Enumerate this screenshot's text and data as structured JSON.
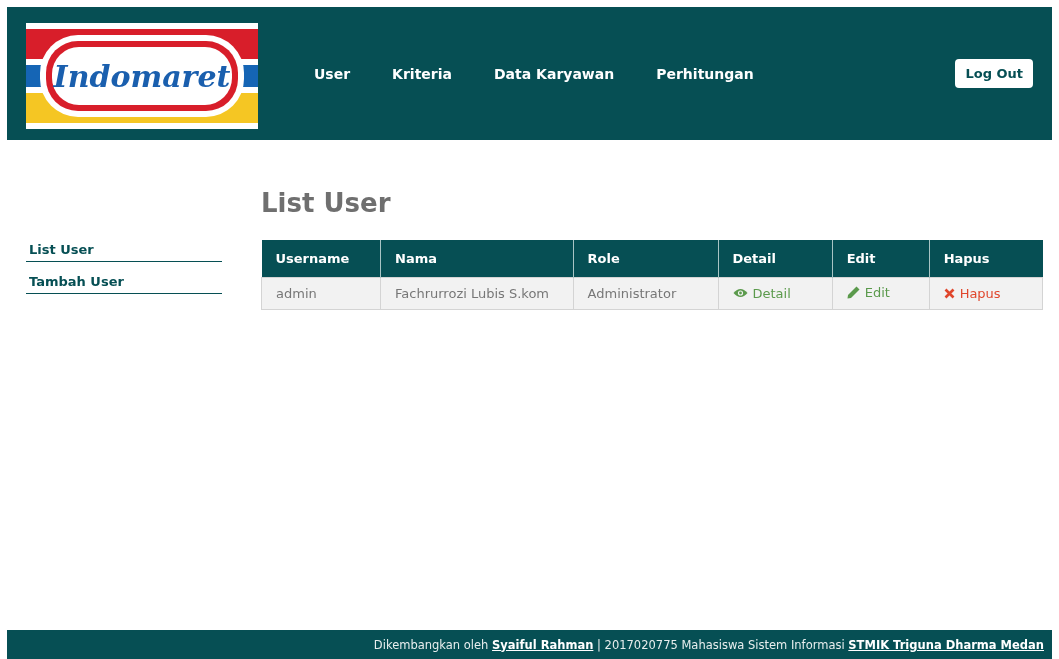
{
  "header": {
    "logo_text": "Indomaret",
    "nav": [
      {
        "label": "User"
      },
      {
        "label": "Kriteria"
      },
      {
        "label": "Data Karyawan"
      },
      {
        "label": "Perhitungan"
      }
    ],
    "logout": "Log Out"
  },
  "sidebar": {
    "items": [
      {
        "label": "List User"
      },
      {
        "label": "Tambah User"
      }
    ]
  },
  "page_title": "List User",
  "table": {
    "columns": [
      "Username",
      "Nama",
      "Role",
      "Detail",
      "Edit",
      "Hapus"
    ],
    "rows": [
      [
        {
          "kind": "text",
          "text": "admin"
        },
        {
          "kind": "text",
          "text": "Fachrurrozi Lubis S.kom"
        },
        {
          "kind": "text",
          "text": "Administrator"
        },
        {
          "kind": "detail",
          "text": "Detail"
        },
        {
          "kind": "edit",
          "text": "Edit"
        },
        {
          "kind": "delete",
          "text": "Hapus"
        }
      ]
    ]
  },
  "footer": {
    "prefix": "Dikembangkan oleh",
    "author": "Syaiful Rahman",
    "middle": "| 2017020775 Mahasiswa Sistem Informasi",
    "institution": "STMIK Triguna Dharma Medan"
  }
}
